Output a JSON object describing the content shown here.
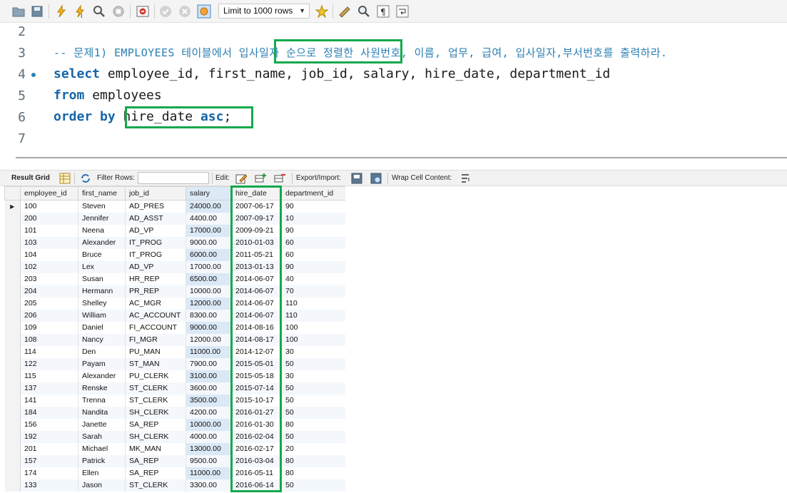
{
  "toolbar": {
    "icons": [
      "open-folder-icon",
      "save-icon",
      "execute-icon",
      "execute-current-icon",
      "explain-icon",
      "stop-icon",
      "toggle-error-icon",
      "commit-icon",
      "rollback-icon",
      "autocommit-icon",
      "beautify-icon",
      "find-icon",
      "invisible-chars-icon",
      "wrap-icon"
    ],
    "limit_label": "Limit to 1000 rows"
  },
  "editor": {
    "line_numbers": [
      "2",
      "3",
      "4",
      "5",
      "6",
      "7"
    ],
    "comment_line": "-- 문제1) EMPLOYEES 테이블에서 입사일자 순으로 정렬한 사원번호, 이름, 업무, 급여, 입사일자,부서번호를 출력하라.",
    "line4_keyword": "select",
    "line4_rest": " employee_id, first_name, job_id, salary, hire_date, department_id",
    "line5_keyword": "from",
    "line5_rest": " employees",
    "line6_keyword": "order by",
    "line6_column": "hire_date",
    "line6_keyword2": "asc",
    "line6_end": ";"
  },
  "result_toolbar": {
    "result_grid_label": "Result Grid",
    "filter_rows_label": "Filter Rows:",
    "filter_value": "",
    "edit_label": "Edit:",
    "export_label": "Export/Import:",
    "wrap_label": "Wrap Cell Content:"
  },
  "grid": {
    "columns": [
      "employee_id",
      "first_name",
      "job_id",
      "salary",
      "hire_date",
      "department_id"
    ],
    "rows": [
      [
        "100",
        "Steven",
        "AD_PRES",
        "24000.00",
        "2007-06-17",
        "90"
      ],
      [
        "200",
        "Jennifer",
        "AD_ASST",
        "4400.00",
        "2007-09-17",
        "10"
      ],
      [
        "101",
        "Neena",
        "AD_VP",
        "17000.00",
        "2009-09-21",
        "90"
      ],
      [
        "103",
        "Alexander",
        "IT_PROG",
        "9000.00",
        "2010-01-03",
        "60"
      ],
      [
        "104",
        "Bruce",
        "IT_PROG",
        "6000.00",
        "2011-05-21",
        "60"
      ],
      [
        "102",
        "Lex",
        "AD_VP",
        "17000.00",
        "2013-01-13",
        "90"
      ],
      [
        "203",
        "Susan",
        "HR_REP",
        "6500.00",
        "2014-06-07",
        "40"
      ],
      [
        "204",
        "Hermann",
        "PR_REP",
        "10000.00",
        "2014-06-07",
        "70"
      ],
      [
        "205",
        "Shelley",
        "AC_MGR",
        "12000.00",
        "2014-06-07",
        "110"
      ],
      [
        "206",
        "William",
        "AC_ACCOUNT",
        "8300.00",
        "2014-06-07",
        "110"
      ],
      [
        "109",
        "Daniel",
        "FI_ACCOUNT",
        "9000.00",
        "2014-08-16",
        "100"
      ],
      [
        "108",
        "Nancy",
        "FI_MGR",
        "12000.00",
        "2014-08-17",
        "100"
      ],
      [
        "114",
        "Den",
        "PU_MAN",
        "11000.00",
        "2014-12-07",
        "30"
      ],
      [
        "122",
        "Payam",
        "ST_MAN",
        "7900.00",
        "2015-05-01",
        "50"
      ],
      [
        "115",
        "Alexander",
        "PU_CLERK",
        "3100.00",
        "2015-05-18",
        "30"
      ],
      [
        "137",
        "Renske",
        "ST_CLERK",
        "3600.00",
        "2015-07-14",
        "50"
      ],
      [
        "141",
        "Trenna",
        "ST_CLERK",
        "3500.00",
        "2015-10-17",
        "50"
      ],
      [
        "184",
        "Nandita",
        "SH_CLERK",
        "4200.00",
        "2016-01-27",
        "50"
      ],
      [
        "156",
        "Janette",
        "SA_REP",
        "10000.00",
        "2016-01-30",
        "80"
      ],
      [
        "192",
        "Sarah",
        "SH_CLERK",
        "4000.00",
        "2016-02-04",
        "50"
      ],
      [
        "201",
        "Michael",
        "MK_MAN",
        "13000.00",
        "2016-02-17",
        "20"
      ],
      [
        "157",
        "Patrick",
        "SA_REP",
        "9500.00",
        "2016-03-04",
        "80"
      ],
      [
        "174",
        "Ellen",
        "SA_REP",
        "11000.00",
        "2016-05-11",
        "80"
      ],
      [
        "133",
        "Jason",
        "ST_CLERK",
        "3300.00",
        "2016-06-14",
        "50"
      ]
    ]
  },
  "colors": {
    "highlight": "#14a84d",
    "keyword": "#1565a9",
    "comment": "#2a7fb3"
  }
}
